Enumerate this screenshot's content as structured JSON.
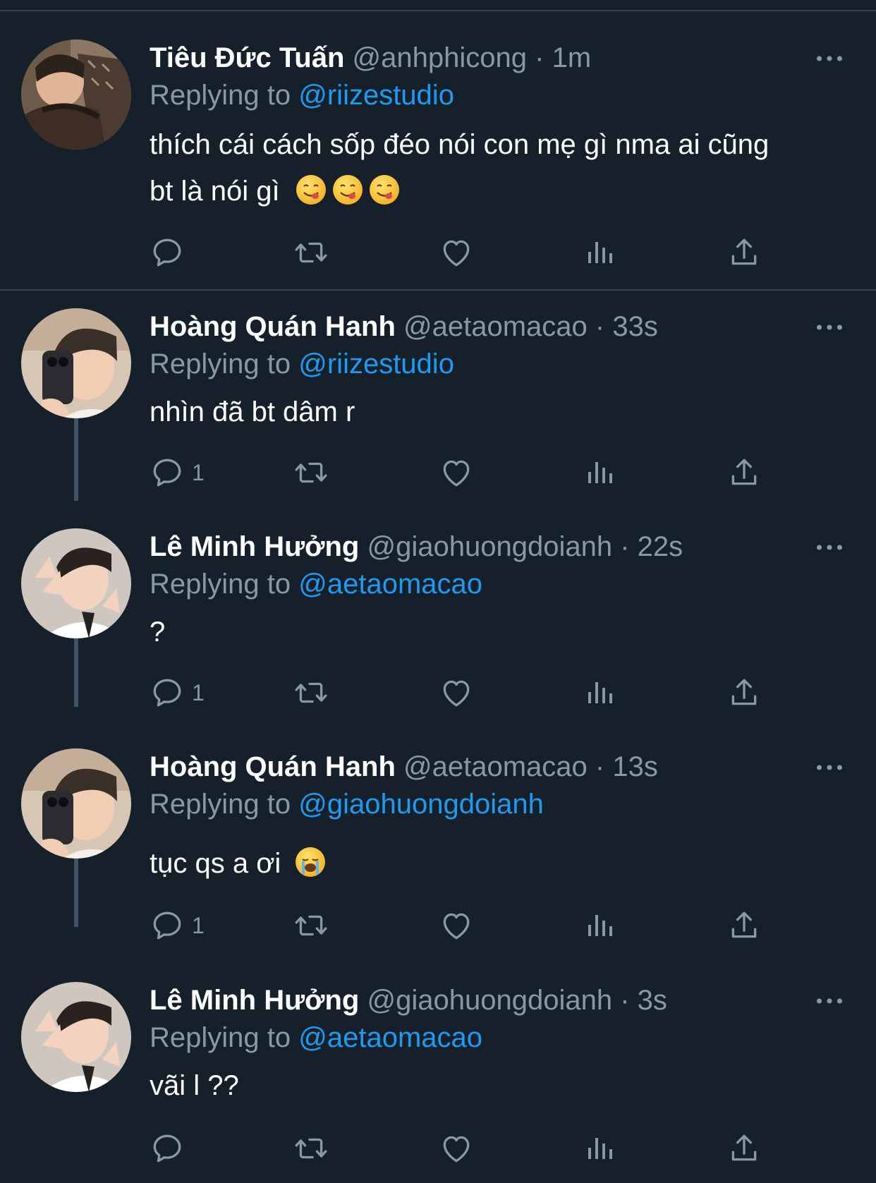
{
  "colors": {
    "background": "#15202b",
    "divider": "#38444d",
    "text_primary": "#ffffff",
    "text_secondary": "#8899a6",
    "mention": "#1d9bf0",
    "thread_line": "#3d5466"
  },
  "icons": [
    "reply-icon",
    "retweet-icon",
    "like-icon",
    "views-icon",
    "share-icon",
    "more-icon"
  ],
  "tweets": [
    {
      "name": "Tiêu Đức Tuấn",
      "handle": "@anhphicong",
      "separator": "·",
      "time": "1m",
      "replying_prefix": "Replying to",
      "replying_to": "@riizestudio",
      "text_line1": "thích cái cách sốp đéo nói con mẹ gì nma ai cũng",
      "text_line2": "bt là nói gì",
      "emojis": [
        "😋",
        "😋",
        "😋"
      ],
      "reply_count": ""
    },
    {
      "name": "Hoàng Quán Hanh",
      "handle": "@aetaomacao",
      "separator": "·",
      "time": "33s",
      "replying_prefix": "Replying to",
      "replying_to": "@riizestudio",
      "text": "nhìn đã bt dâm r",
      "reply_count": "1"
    },
    {
      "name": "Lê Minh Hưởng",
      "handle": "@giaohuongdoianh",
      "separator": "·",
      "time": "22s",
      "replying_prefix": "Replying to",
      "replying_to": "@aetaomacao",
      "text": "?",
      "reply_count": "1"
    },
    {
      "name": "Hoàng Quán Hanh",
      "handle": "@aetaomacao",
      "separator": "·",
      "time": "13s",
      "replying_prefix": "Replying to",
      "replying_to": "@giaohuongdoianh",
      "text": "tục qs a ơi",
      "emojis": [
        "😭"
      ],
      "reply_count": "1"
    },
    {
      "name": "Lê Minh Hưởng",
      "handle": "@giaohuongdoianh",
      "separator": "·",
      "time": "3s",
      "replying_prefix": "Replying to",
      "replying_to": "@aetaomacao",
      "text": "vãi l ??",
      "reply_count": ""
    }
  ]
}
